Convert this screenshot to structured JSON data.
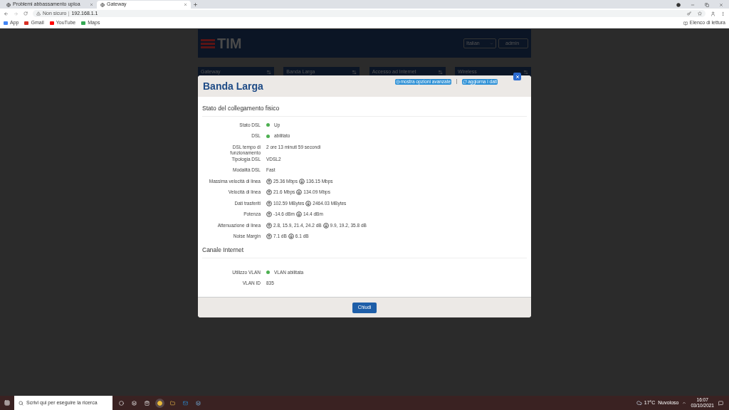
{
  "browser": {
    "tabs": [
      {
        "title": "Problemi abbassamento uploa",
        "selected": false
      },
      {
        "title": "Gateway",
        "selected": true
      }
    ],
    "security": "Non sicuro",
    "url": "192.168.1.1",
    "bookmarks": [
      "App",
      "Gmail",
      "YouTube",
      "Maps"
    ],
    "reading_list": "Elenco di lettura"
  },
  "header": {
    "logo": "TIM",
    "language": "Italian",
    "user": "admin"
  },
  "nav": [
    "Gateway",
    "Banda Larga",
    "Accesso ad Internet",
    "Wireless"
  ],
  "modal": {
    "title": "Banda Larga",
    "actions": [
      "mostra opzioni avanzate",
      "aggiorna i dati"
    ],
    "sections": [
      {
        "title": "Stato del collegamento fisico",
        "rows": [
          {
            "kind": "status",
            "label": "Stato DSL",
            "value": "Up",
            "color": "#4caf50"
          },
          {
            "kind": "status",
            "label": "DSL",
            "value": "abilitato",
            "color": "#4caf50"
          },
          {
            "kind": "text",
            "label": "DSL tempo di funzionamento",
            "value": "2 ore 13 minuti 59 secondi"
          },
          {
            "kind": "text",
            "label": "Tipologia DSL",
            "value": "VDSL2"
          },
          {
            "kind": "text",
            "label": "Modalità DSL",
            "value": "Fast"
          },
          {
            "kind": "updown",
            "label": "Massima velocità di linea",
            "up": "25.36 Mbps",
            "down": "136.15 Mbps"
          },
          {
            "kind": "updown",
            "label": "Velocità di linea",
            "up": "21.6 Mbps",
            "down": "134.09 Mbps"
          },
          {
            "kind": "updown",
            "label": "Dati trasferiti",
            "up": "102.59 MBytes",
            "down": "2464.03 MBytes"
          },
          {
            "kind": "updown",
            "label": "Potenza",
            "up": "-14.6 dBm",
            "down": "14.4 dBm"
          },
          {
            "kind": "updown",
            "label": "Attenuazione di linea",
            "up": "2.8, 15.9, 21.4, 24.2 dB",
            "down": "9.9, 19.2, 35.8 dB"
          },
          {
            "kind": "updown",
            "label": "Noise Margin",
            "up": "7.1 dB",
            "down": "6.1 dB"
          }
        ]
      },
      {
        "title": "Canale Internet",
        "rows": [
          {
            "kind": "status",
            "label": "Utilizzo VLAN",
            "value": "VLAN abilitata",
            "color": "#4caf50"
          },
          {
            "kind": "text",
            "label": "VLAN ID",
            "value": "835"
          }
        ]
      }
    ],
    "close": "Chiudi"
  },
  "taskbar": {
    "search_placeholder": "Scrivi qui per eseguire la ricerca",
    "weather": "17°C  Nuvoloso",
    "time": "16:07",
    "date": "03/10/2021"
  }
}
